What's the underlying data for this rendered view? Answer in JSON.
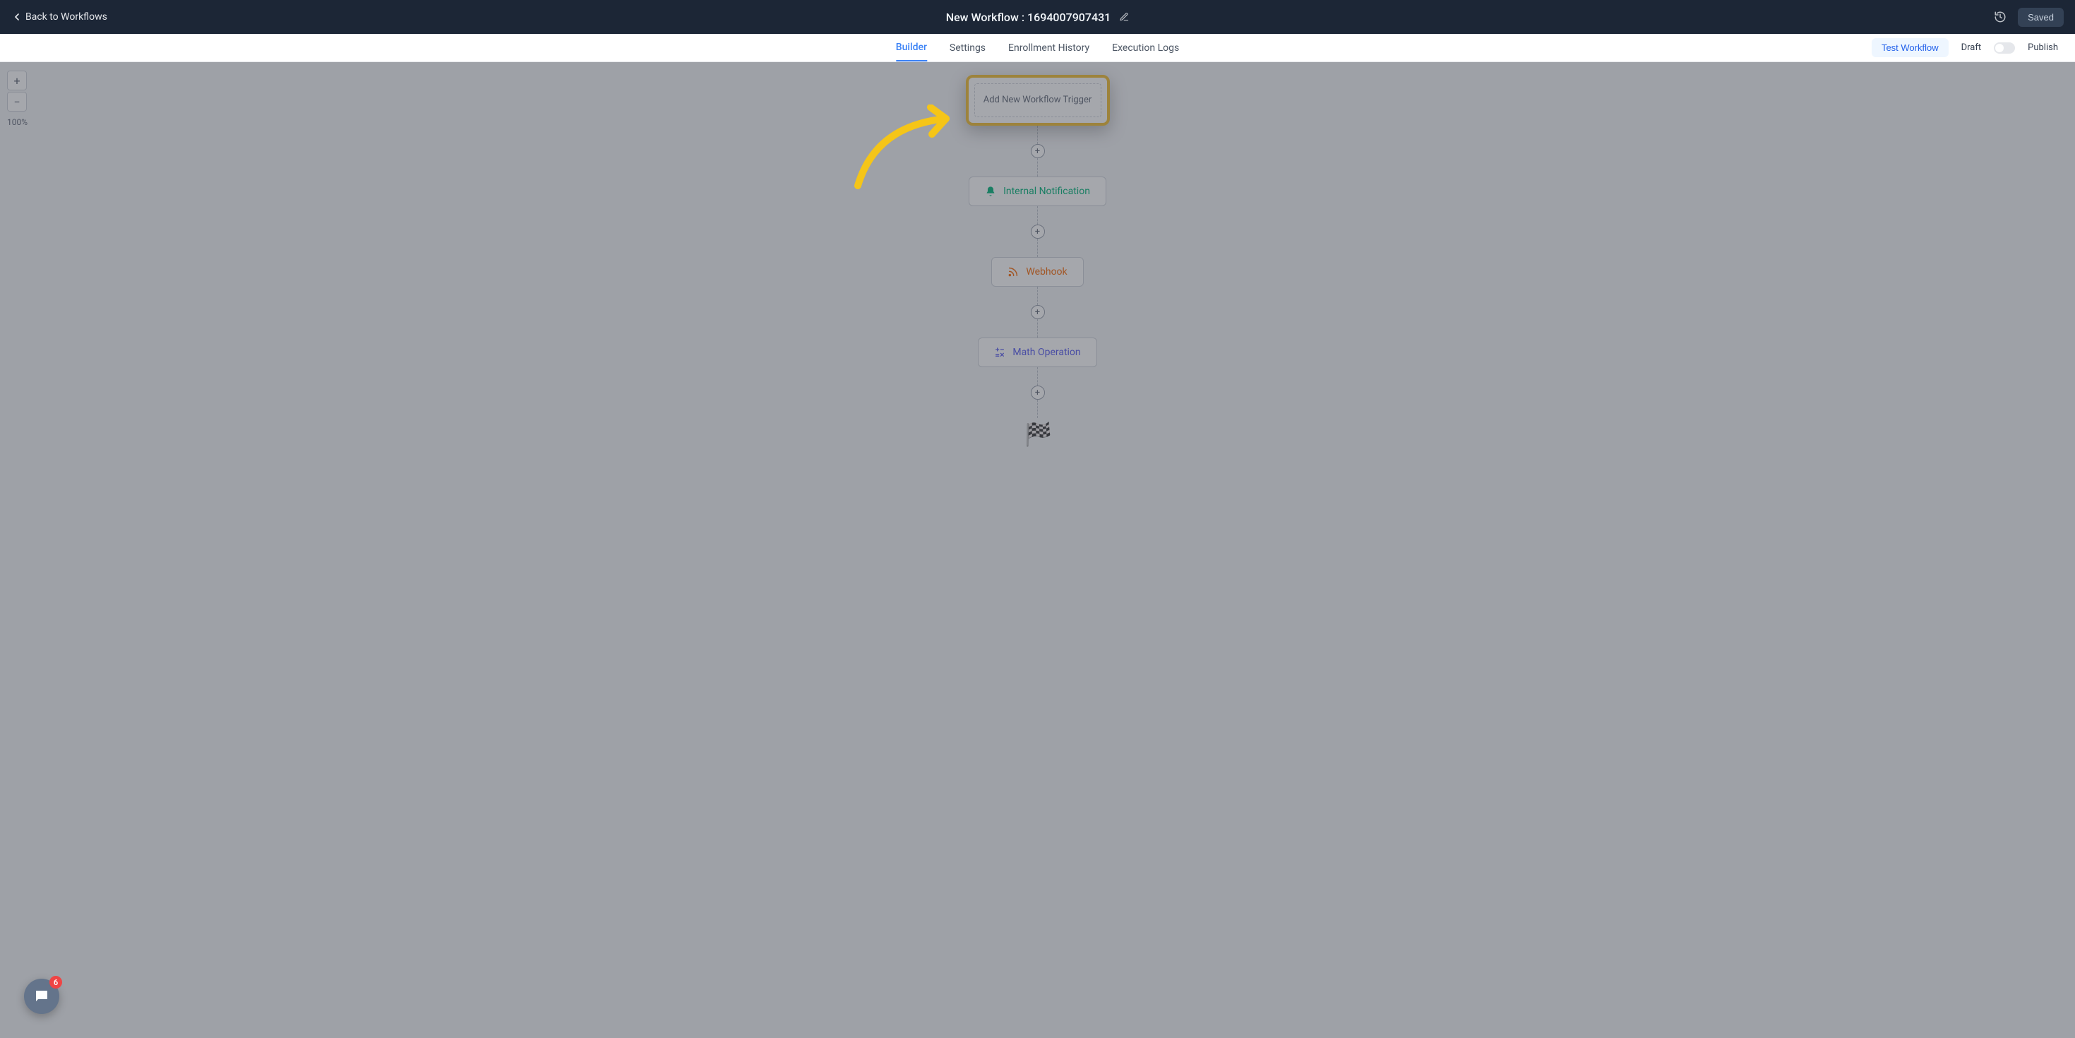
{
  "header": {
    "back_label": "Back to Workflows",
    "title": "New Workflow : 1694007907431",
    "saved_label": "Saved"
  },
  "tabs": {
    "builder": "Builder",
    "settings": "Settings",
    "enrollment_history": "Enrollment History",
    "execution_logs": "Execution Logs",
    "active": "builder"
  },
  "actions": {
    "test_workflow": "Test Workflow",
    "draft": "Draft",
    "publish": "Publish",
    "toggle_on": false
  },
  "zoom": {
    "level": "100%"
  },
  "flow": {
    "trigger_label": "Add New Workflow Trigger",
    "steps": [
      {
        "label": "Internal Notification",
        "icon": "bell-icon",
        "color": "green"
      },
      {
        "label": "Webhook",
        "icon": "rss-icon",
        "color": "red"
      },
      {
        "label": "Math Operation",
        "icon": "math-icon",
        "color": "purple"
      }
    ]
  },
  "chat": {
    "badge_count": "6"
  }
}
